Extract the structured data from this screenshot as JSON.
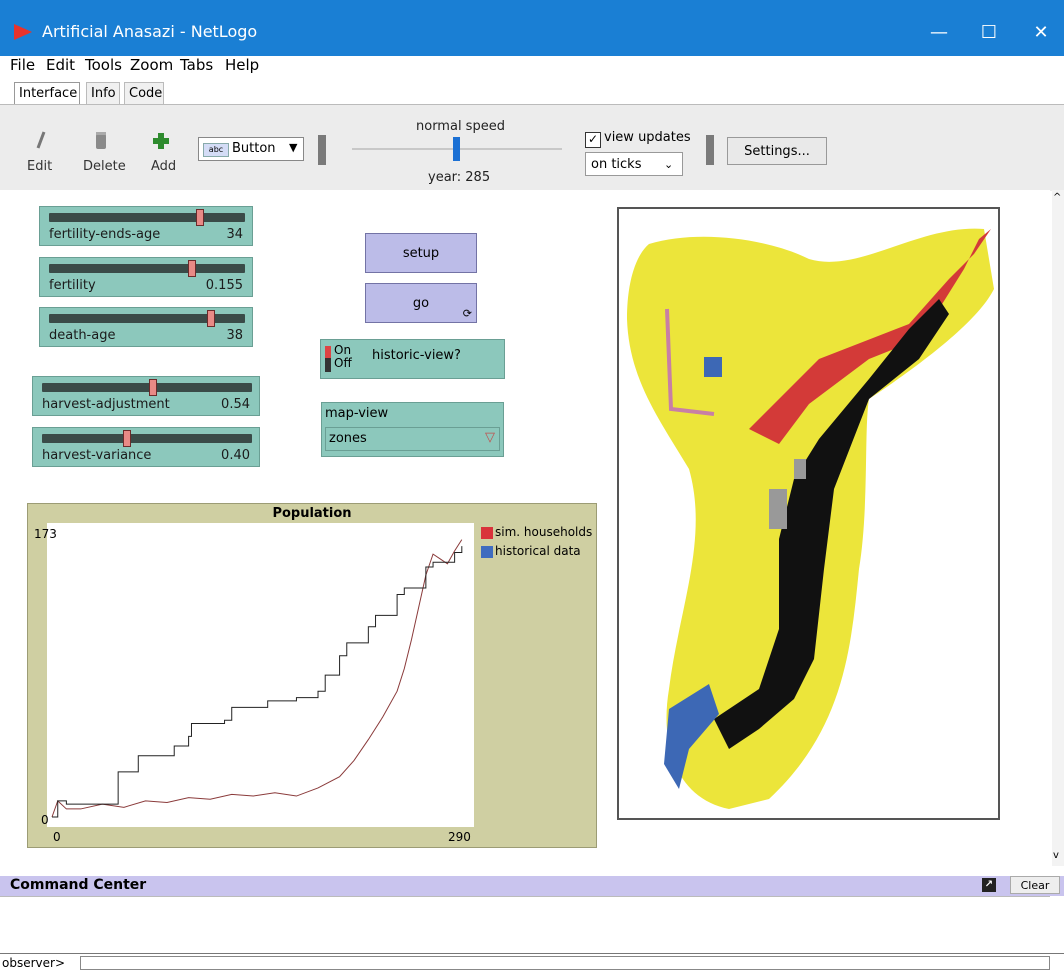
{
  "window": {
    "title": "Artificial Anasazi - NetLogo",
    "minimize": "—",
    "maximize": "☐",
    "close": "✕"
  },
  "menu": [
    "File",
    "Edit",
    "Tools",
    "Zoom",
    "Tabs",
    "Help"
  ],
  "tabs": [
    "Interface",
    "Info",
    "Code"
  ],
  "toolbar": {
    "edit": "Edit",
    "delete": "Delete",
    "add": "Add",
    "widget_type": "Button",
    "speed_label": "normal speed",
    "tick_label": "year: 285",
    "view_updates_label": "view updates",
    "view_updates_checked": true,
    "update_mode": "on ticks",
    "settings": "Settings..."
  },
  "sliders": [
    {
      "name": "fertility-ends-age",
      "value": "34",
      "position": 0.78
    },
    {
      "name": "fertility",
      "value": "0.155",
      "position": 0.74
    },
    {
      "name": "death-age",
      "value": "38",
      "position": 0.84
    },
    {
      "name": "harvest-adjustment",
      "value": "0.54",
      "position": 0.53
    },
    {
      "name": "harvest-variance",
      "value": "0.40",
      "position": 0.4
    }
  ],
  "buttons": {
    "setup": "setup",
    "go": "go"
  },
  "switch": {
    "on": "On",
    "off": "Off",
    "name": "historic-view?"
  },
  "chooser": {
    "name": "map-view",
    "value": "zones"
  },
  "chart_data": {
    "type": "line",
    "title": "Population",
    "xlim": [
      0,
      290
    ],
    "ylim": [
      0,
      173
    ],
    "x_min_label": "0",
    "x_max_label": "290",
    "y_min_label": "0",
    "y_max_label": "173",
    "series": [
      {
        "name": "sim. households",
        "color": "#d9333b",
        "x": [
          0,
          4,
          10,
          20,
          35,
          50,
          65,
          80,
          95,
          110,
          125,
          140,
          155,
          170,
          185,
          200,
          210,
          220,
          230,
          240,
          245,
          250,
          255,
          260,
          265,
          270,
          275,
          280,
          285
        ],
        "y": [
          0,
          10,
          5,
          5,
          8,
          6,
          10,
          9,
          12,
          11,
          14,
          13,
          15,
          13,
          18,
          25,
          35,
          48,
          62,
          78,
          92,
          110,
          130,
          150,
          163,
          160,
          157,
          165,
          172
        ]
      },
      {
        "name": "historical data",
        "color": "#3f6cbf",
        "x": [
          0,
          4,
          10,
          30,
          45,
          46,
          60,
          85,
          95,
          97,
          120,
          125,
          150,
          170,
          185,
          190,
          200,
          205,
          220,
          225,
          240,
          245,
          260,
          265,
          280,
          285
        ],
        "y": [
          0,
          10,
          8,
          8,
          8,
          28,
          38,
          44,
          50,
          58,
          60,
          68,
          72,
          74,
          78,
          88,
          100,
          108,
          118,
          125,
          138,
          142,
          155,
          158,
          164,
          168
        ]
      }
    ]
  },
  "command_center": {
    "title": "Command Center",
    "clear": "Clear",
    "prompt": "observer>"
  }
}
